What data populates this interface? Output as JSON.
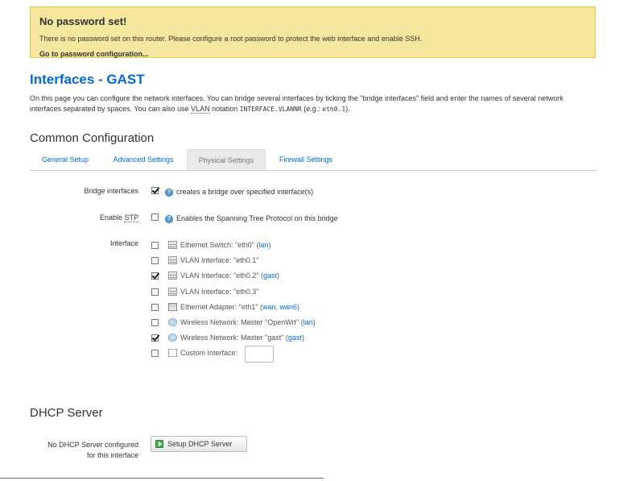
{
  "alert": {
    "title": "No password set!",
    "text": "There is no password set on this router. Please configure a root password to protect the web interface and enable SSH.",
    "link": "Go to password configuration..."
  },
  "page": {
    "title": "Interfaces - GAST",
    "desc_part1": "On this page you can configure the network interfaces. You can bridge several interfaces by ticking the \"bridge interfaces\" field and enter the names of several network interfaces separated by spaces. You can also use ",
    "desc_vlan": "VLAN",
    "desc_part2": " notation ",
    "desc_mono1": "INTERFACE.VLANNR",
    "desc_part3": " (e.g.: ",
    "desc_mono2": "eth0.1",
    "desc_part4": ")."
  },
  "common": {
    "heading": "Common Configuration",
    "tabs": [
      "General Setup",
      "Advanced Settings",
      "Physical Settings",
      "Firewall Settings"
    ]
  },
  "form": {
    "bridge_label": "Bridge interfaces",
    "bridge_checked": true,
    "bridge_help": "creates a bridge over specified interface(s)",
    "stp_label_prefix": "Enable ",
    "stp_abbr": "STP",
    "stp_checked": false,
    "stp_help": "Enables the Spanning Tree Protocol on this bridge",
    "interface_label": "Interface",
    "interfaces": [
      {
        "icon": "ethernet-switch-icon",
        "text": "Ethernet Switch: \"eth0\" (",
        "links": [
          "lan"
        ],
        "suffix": ")",
        "checked": false
      },
      {
        "icon": "vlan-interface-icon",
        "text": "VLAN Interface: \"eth0.1\"",
        "links": [],
        "suffix": "",
        "checked": false
      },
      {
        "icon": "vlan-interface-icon",
        "text": "VLAN Interface: \"eth0.2\" (",
        "links": [
          "gast"
        ],
        "suffix": ")",
        "checked": true
      },
      {
        "icon": "vlan-interface-icon",
        "text": "VLAN Interface: \"eth0.3\"",
        "links": [],
        "suffix": "",
        "checked": false
      },
      {
        "icon": "ethernet-adapter-icon",
        "text": "Ethernet Adapter: \"eth1\" (",
        "links": [
          "wan",
          "wan6"
        ],
        "suffix": ")",
        "checked": false
      },
      {
        "icon": "wireless-network-icon",
        "text": "Wireless Network: Master \"OpenWrt\" (",
        "links": [
          "lan"
        ],
        "suffix": ")",
        "checked": false
      },
      {
        "icon": "wireless-network-icon",
        "text": "Wireless Network: Master \"gast\" (",
        "links": [
          "gast"
        ],
        "suffix": ")",
        "checked": true
      },
      {
        "icon": "custom-interface-icon",
        "text": "Custom Interface:",
        "links": [],
        "suffix": "",
        "checked": false
      }
    ],
    "custom_value": ""
  },
  "dhcp": {
    "heading": "DHCP Server",
    "label_line1": "No DHCP Server configured",
    "label_line2": "for this interface",
    "button": "Setup DHCP Server"
  }
}
